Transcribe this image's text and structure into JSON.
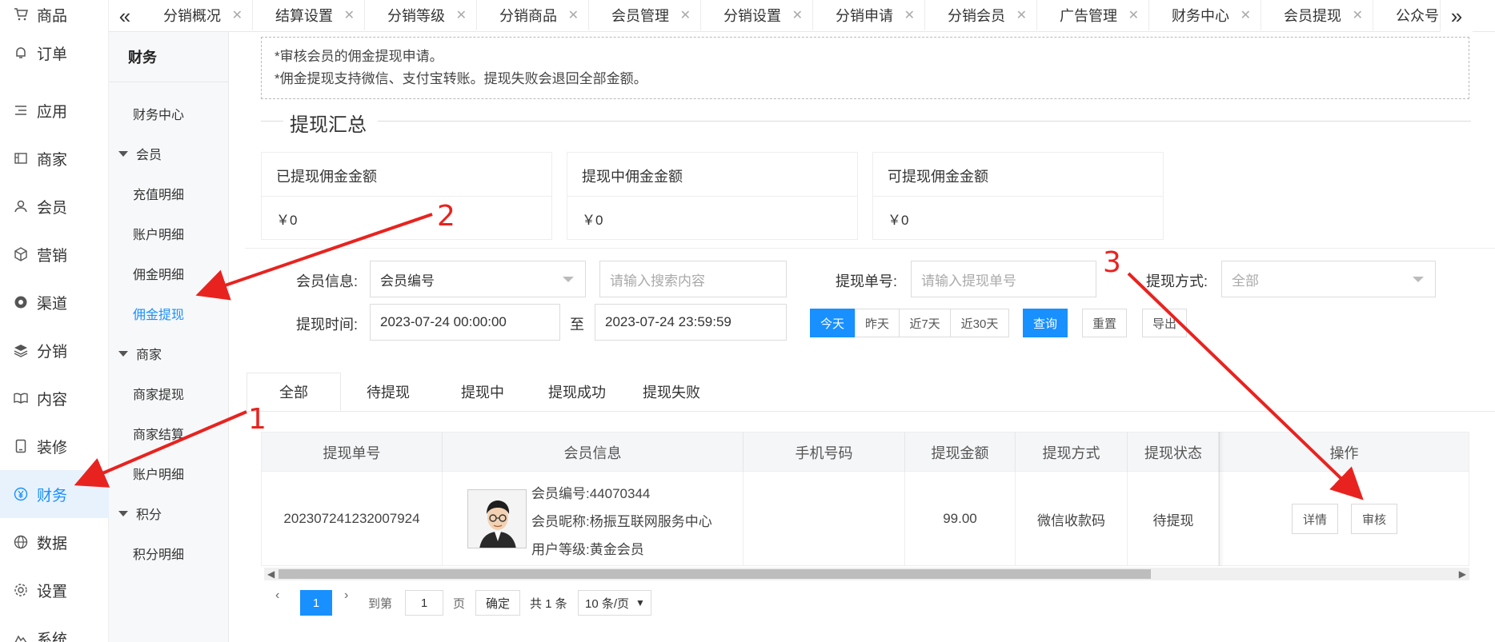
{
  "sidebar": {
    "items": [
      {
        "label": "商品",
        "icon": "cart-icon"
      },
      {
        "label": "订单",
        "icon": "bell-icon"
      },
      {
        "label": "应用",
        "icon": "list-icon"
      },
      {
        "label": "商家",
        "icon": "store-icon"
      },
      {
        "label": "会员",
        "icon": "user-icon"
      },
      {
        "label": "营销",
        "icon": "cube-icon"
      },
      {
        "label": "渠道",
        "icon": "channel-icon"
      },
      {
        "label": "分销",
        "icon": "layers-icon"
      },
      {
        "label": "内容",
        "icon": "book-icon"
      },
      {
        "label": "装修",
        "icon": "tablet-icon"
      },
      {
        "label": "财务",
        "icon": "yen-icon",
        "active": true
      },
      {
        "label": "数据",
        "icon": "globe-icon"
      },
      {
        "label": "设置",
        "icon": "gear-icon"
      },
      {
        "label": "系统",
        "icon": "system-icon"
      }
    ]
  },
  "subnav": {
    "title": "财务",
    "finance_center": "财务中心",
    "group_member": "会员",
    "recharge": "充值明细",
    "account": "账户明细",
    "commission": "佣金明细",
    "commission_withdraw": "佣金提现",
    "group_merchant": "商家",
    "merchant_withdraw": "商家提现",
    "merchant_settle": "商家结算",
    "merchant_account": "账户明细",
    "group_points": "积分",
    "points_detail": "积分明细"
  },
  "tabs": [
    "分销概况",
    "结算设置",
    "分销等级",
    "分销商品",
    "会员管理",
    "分销设置",
    "分销申请",
    "分销会员",
    "广告管理",
    "财务中心",
    "会员提现",
    "公众号"
  ],
  "notice": {
    "line1": "*审核会员的佣金提现申请。",
    "line2": "*佣金提现支持微信、支付宝转账。提现失败会退回全部金额。"
  },
  "summary": {
    "title": "提现汇总",
    "cards": [
      {
        "label": "已提现佣金金额",
        "value": "￥0"
      },
      {
        "label": "提现中佣金金额",
        "value": "￥0"
      },
      {
        "label": "可提现佣金金额",
        "value": "￥0"
      }
    ]
  },
  "filters": {
    "member_label": "会员信息:",
    "member_select": "会员编号",
    "search_placeholder": "请输入搜索内容",
    "order_label": "提现单号:",
    "order_placeholder": "请输入提现单号",
    "method_label": "提现方式:",
    "method_select": "全部",
    "time_label": "提现时间:",
    "time_start": "2023-07-24 00:00:00",
    "time_to": "至",
    "time_end": "2023-07-24 23:59:59",
    "quick": [
      "今天",
      "昨天",
      "近7天",
      "近30天"
    ],
    "query": "查询",
    "reset": "重置",
    "export": "导出"
  },
  "status_tabs": [
    "全部",
    "待提现",
    "提现中",
    "提现成功",
    "提现失败"
  ],
  "table": {
    "headers": [
      "提现单号",
      "会员信息",
      "手机号码",
      "提现金额",
      "提现方式",
      "提现状态",
      "操作"
    ],
    "rows": [
      {
        "order_no": "202307241232007924",
        "member_no": "会员编号:44070344",
        "nickname": "会员昵称:杨振互联网服务中心",
        "level": "用户等级:黄金会员",
        "phone": "",
        "amount": "99.00",
        "method": "微信收款码",
        "status": "待提现",
        "actions": [
          "详情",
          "审核"
        ]
      }
    ]
  },
  "pagination": {
    "current": "1",
    "goto": "到第",
    "page_input": "1",
    "page_unit": "页",
    "confirm": "确定",
    "total": "共 1 条",
    "page_size": "10 条/页"
  },
  "annotations": [
    "1",
    "2",
    "3"
  ],
  "colors": {
    "accent": "#1890ff",
    "annotation": "#e8231f"
  }
}
